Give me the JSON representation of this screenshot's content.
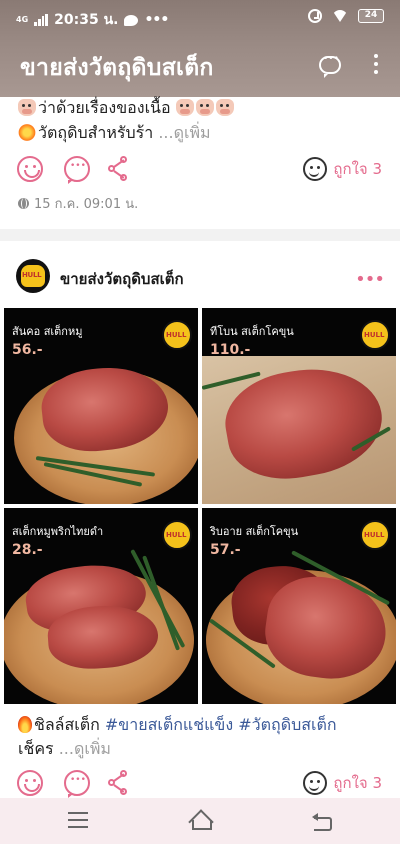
{
  "status_bar": {
    "network": "4G",
    "time": "20:35 น.",
    "battery": "24"
  },
  "app_bar": {
    "title": "ขายส่งวัตถุดิบสเต็ก"
  },
  "post1": {
    "line1": "ว่าด้วยเรื่องของเนื้อ",
    "line2": "วัตถุดิบสำหรับร้า",
    "see_more": "...ดูเพิ่ม",
    "like_label": "ถูกใจ 3",
    "timestamp": "15 ก.ค. 09:01 น."
  },
  "post2": {
    "page_name": "ขายส่งวัตถุดิบสเต็ก",
    "more_dots": "•••",
    "photos": [
      {
        "label": "สันคอ สเต็กหมู",
        "price": "56.-"
      },
      {
        "label": "ทีโบน สเต็กโคขุน",
        "price": "110.-"
      },
      {
        "label": "สเต็กหมูพริกไทยดำ",
        "price": "28.-"
      },
      {
        "label": "ริบอาย สเต็กโคขุน",
        "price": "57.-"
      }
    ],
    "caption_start": "ชิลล์สเต็ก",
    "hashtag1": "#ขายสเต็กแช่แข็ง",
    "hashtag2": "#วัตถุดิบสเต็ก",
    "caption_line2": "เช็คร",
    "see_more": "...ดูเพิ่ม",
    "like_label": "ถูกใจ 3"
  },
  "colors": {
    "accent": "#e46b8d",
    "hashtag": "#3b5998",
    "navbar_bg": "#f8ecef"
  }
}
